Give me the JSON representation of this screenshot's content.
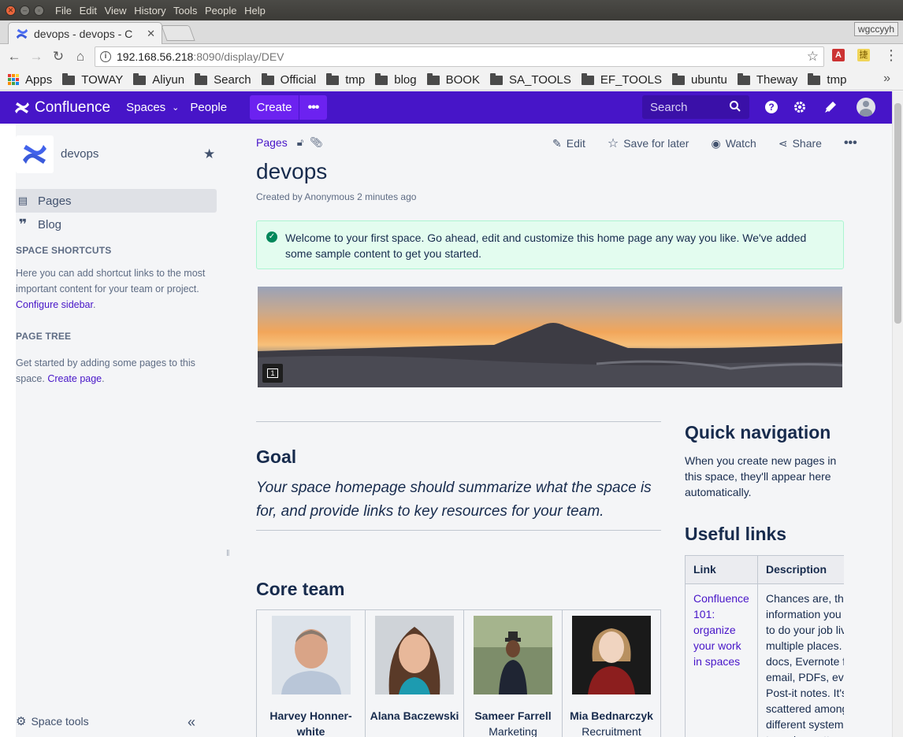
{
  "os": {
    "menu": [
      "File",
      "Edit",
      "View",
      "History",
      "Tools",
      "People",
      "Help"
    ]
  },
  "browser": {
    "tab_title": "devops - devops - C",
    "profile": "wgccyyh",
    "url_host": "192.168.56.218",
    "url_rest": ":8090/display/DEV",
    "bookmarks": [
      "Apps",
      "TOWAY",
      "Aliyun",
      "Search",
      "Official",
      "tmp",
      "blog",
      "BOOK",
      "SA_TOOLS",
      "EF_TOOLS",
      "ubuntu",
      "Theway",
      "tmp"
    ],
    "ext1": "A",
    "ext2": "捷"
  },
  "header": {
    "logo_text": "Confluence",
    "spaces": "Spaces",
    "people": "People",
    "create": "Create",
    "more": "•••",
    "search_placeholder": "Search",
    "help": "?",
    "brand_color": "#4715c8"
  },
  "sidebar": {
    "space_name": "devops",
    "items": [
      {
        "label": "Pages",
        "icon": "pages-icon"
      },
      {
        "label": "Blog",
        "icon": "quote-icon"
      }
    ],
    "shortcuts_heading": "SPACE SHORTCUTS",
    "shortcuts_text": "Here you can add shortcut links to the most important content for your team or project.",
    "shortcuts_link": "Configure sidebar",
    "tree_heading": "PAGE TREE",
    "tree_text": "Get started by adding some pages to this space.",
    "tree_link": "Create page",
    "space_tools": "Space tools"
  },
  "page": {
    "breadcrumb": "Pages",
    "actions": {
      "edit": "Edit",
      "save": "Save for later",
      "watch": "Watch",
      "share": "Share",
      "more": "•••"
    },
    "title": "devops",
    "byline": "Created by Anonymous 2 minutes ago",
    "alert": "Welcome to your first space. Go ahead, edit and customize this home page any way you like. We've added some sample content to get you started.",
    "comment_count": "1",
    "goal_heading": "Goal",
    "goal_text": "Your space homepage should summarize what the space is for, and provide links to key resources for your team.",
    "core_team_heading": "Core team",
    "team": [
      {
        "name": "Harvey Honner-white",
        "role": ""
      },
      {
        "name": "Alana Baczewski",
        "role": ""
      },
      {
        "name": "Sameer Farrell",
        "role": "Marketing"
      },
      {
        "name": "Mia Bednarczyk",
        "role": "Recruitment"
      }
    ],
    "quick_nav_heading": "Quick navigation",
    "quick_nav_text": "When you create new pages in this space, they'll appear here automatically.",
    "useful_links_heading": "Useful links",
    "links_table": {
      "headers": [
        "Link",
        "Description"
      ],
      "rows": [
        {
          "link": "Confluence 101: organize your work in spaces",
          "description": "Chances are, the information you need to do your job lives in multiple places. Word docs, Evernote files, email, PDFs, even Post-it notes. It's scattered among different systems. And to make matters"
        }
      ]
    }
  }
}
